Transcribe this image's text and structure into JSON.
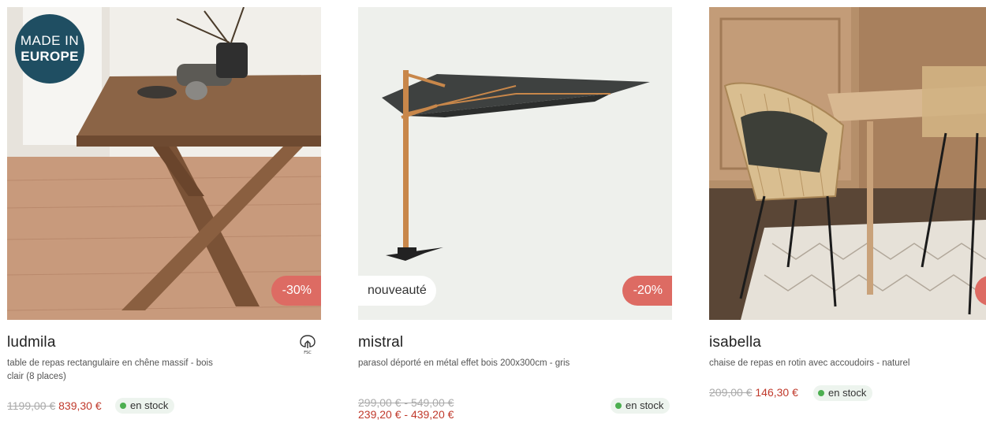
{
  "products": [
    {
      "badge_line1": "MADE IN",
      "badge_line2": "EUROPE",
      "discount": "-30%",
      "title": "ludmila",
      "description": "table de repas rectangulaire en chêne massif - bois clair (8 places)",
      "old_price": "1199,00 €",
      "new_price": "839,30 €",
      "stock": "en stock",
      "label_icon": "fsc-tree-icon"
    },
    {
      "tag": "nouveauté",
      "discount": "-20%",
      "title": "mistral",
      "description": "parasol déporté en métal effet bois 200x300cm - gris",
      "old_price": "299,00 € - 549,00 €",
      "new_price": "239,20 € - 439,20 €",
      "stock": "en stock"
    },
    {
      "title": "isabella",
      "description": "chaise de repas en rotin avec accoudoirs - naturel",
      "old_price": "209,00 €",
      "new_price": "146,30 €",
      "stock": "en stock"
    }
  ],
  "colors": {
    "badge_bg": "#1f4e62",
    "discount_bg": "#dd6b63",
    "price_new": "#c0392b",
    "stock_dot": "#4caf50"
  }
}
